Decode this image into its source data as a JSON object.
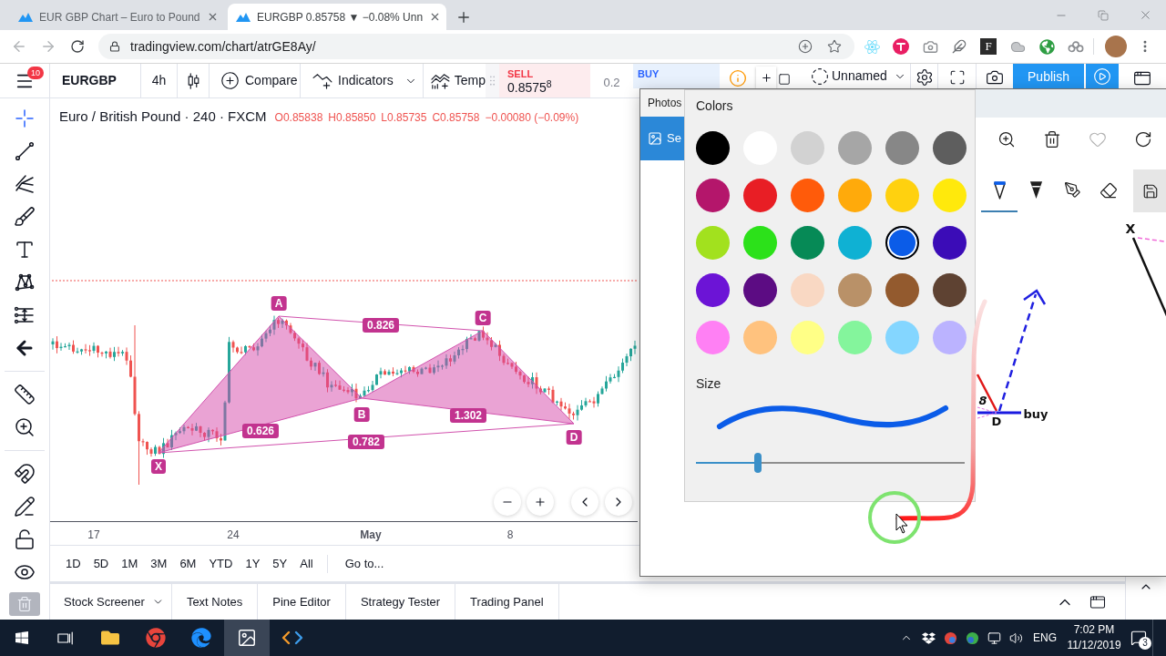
{
  "browser": {
    "tabs": [
      {
        "title": "EUR GBP Chart – Euro to Pound",
        "selected": false
      },
      {
        "title": "EURGBP 0.85758 ▼ −0.08% Unn",
        "selected": true
      }
    ],
    "url": "tradingview.com/chart/atrGE8Ay/",
    "extension_tile": "F"
  },
  "toolbar": {
    "menu_badge": "10",
    "symbol": "EURGBP",
    "interval": "4h",
    "compare": "Compare",
    "indicators": "Indicators",
    "templates": "Temp",
    "sell": {
      "label": "SELL",
      "price": "0.8575$^{8}$"
    },
    "spread": "0.2",
    "buy": {
      "label": "BUY"
    },
    "layout_name": "Unnamed",
    "publish": "Publish"
  },
  "drawing_tools": [
    {
      "kind": "crosshair",
      "selected": true
    },
    {
      "kind": "trend-line",
      "selected": false
    },
    {
      "kind": "pitchfork",
      "selected": false
    },
    {
      "kind": "brush",
      "selected": false
    },
    {
      "kind": "text",
      "selected": false
    },
    {
      "kind": "pattern",
      "selected": false
    },
    {
      "kind": "projection",
      "selected": false
    },
    {
      "kind": "back",
      "selected": false
    },
    {
      "kind": "ruler",
      "selected": false
    },
    {
      "kind": "zoom",
      "selected": false
    },
    {
      "kind": "magnet",
      "selected": false
    },
    {
      "kind": "lock-drawing",
      "selected": false
    },
    {
      "kind": "lock",
      "selected": false
    },
    {
      "kind": "eye",
      "selected": false
    },
    {
      "kind": "remove",
      "selected": false
    }
  ],
  "chart": {
    "title": "Euro / British Pound · 240 · FXCM",
    "ohlc": [
      "O0.85838",
      "H0.85850",
      "L0.85735",
      "C0.85758",
      "−0.00080 (−0.09%)"
    ],
    "pattern_points": [
      "X",
      "A",
      "B",
      "C",
      "D"
    ],
    "ratios": [
      "0.626",
      "0.826",
      "1.302",
      "0.782"
    ],
    "time_axis": [
      {
        "label": "17",
        "kind": "day"
      },
      {
        "label": "24",
        "kind": "day"
      },
      {
        "label": "May",
        "kind": "month"
      },
      {
        "label": "8",
        "kind": "day"
      }
    ]
  },
  "ranges": [
    "1D",
    "5D",
    "1M",
    "3M",
    "6M",
    "YTD",
    "1Y",
    "5Y",
    "All"
  ],
  "goto": "Go to...",
  "bottom_tabs": [
    {
      "label": "Stock Screener",
      "kind": "dropdown"
    },
    {
      "label": "Text Notes",
      "kind": "tab"
    },
    {
      "label": "Pine Editor",
      "kind": "tab"
    },
    {
      "label": "Strategy Tester",
      "kind": "tab"
    },
    {
      "label": "Trading Panel",
      "kind": "tab"
    }
  ],
  "photos": {
    "title": "Photos",
    "nav_item": "Se",
    "colors_heading": "Colors",
    "swatches": [
      {
        "color": "#000000",
        "selected": false
      },
      {
        "color": "#ffffff",
        "selected": false
      },
      {
        "color": "#d2d2d2",
        "selected": false
      },
      {
        "color": "#a6a6a6",
        "selected": false
      },
      {
        "color": "#878787",
        "selected": false
      },
      {
        "color": "#5e5e5e",
        "selected": false
      },
      {
        "color": "#b4166b",
        "selected": false
      },
      {
        "color": "#e81e25",
        "selected": false
      },
      {
        "color": "#ff5b0a",
        "selected": false
      },
      {
        "color": "#ffaa0b",
        "selected": false
      },
      {
        "color": "#ffd10f",
        "selected": false
      },
      {
        "color": "#ffe90c",
        "selected": false
      },
      {
        "color": "#a2e11e",
        "selected": false
      },
      {
        "color": "#2ce11a",
        "selected": false
      },
      {
        "color": "#068a56",
        "selected": false
      },
      {
        "color": "#0fb1d3",
        "selected": false
      },
      {
        "color": "#0b5ce8",
        "selected": true
      },
      {
        "color": "#3b0cb7",
        "selected": false
      },
      {
        "color": "#6c14d6",
        "selected": false
      },
      {
        "color": "#5c0c83",
        "selected": false
      },
      {
        "color": "#f9d8c3",
        "selected": false
      },
      {
        "color": "#b99168",
        "selected": false
      },
      {
        "color": "#935a2e",
        "selected": false
      },
      {
        "color": "#5e4232",
        "selected": false
      },
      {
        "color": "#ff80f4",
        "selected": false
      },
      {
        "color": "#ffc27e",
        "selected": false
      },
      {
        "color": "#ffff86",
        "selected": false
      },
      {
        "color": "#84f59c",
        "selected": false
      },
      {
        "color": "#84d6ff",
        "selected": false
      },
      {
        "color": "#bbb3ff",
        "selected": false
      }
    ],
    "size_label": "Size",
    "size": {
      "level": 0.23
    },
    "tools": [
      {
        "kind": "ballpoint",
        "selected": true
      },
      {
        "kind": "pencil",
        "selected": false
      },
      {
        "kind": "calligraphy",
        "selected": false
      },
      {
        "kind": "eraser",
        "selected": false
      }
    ],
    "canvas_labels": [
      "X",
      "8",
      "D",
      "buy"
    ]
  },
  "taskbar": {
    "apps": [
      {
        "kind": "explorer",
        "selected": false
      },
      {
        "kind": "chrome",
        "selected": false
      },
      {
        "kind": "edge",
        "selected": false
      },
      {
        "kind": "photos",
        "selected": true
      },
      {
        "kind": "code",
        "selected": false
      }
    ],
    "language": "ENG",
    "time": "7:02 PM",
    "date": "11/12/2019",
    "notifications": "3"
  }
}
